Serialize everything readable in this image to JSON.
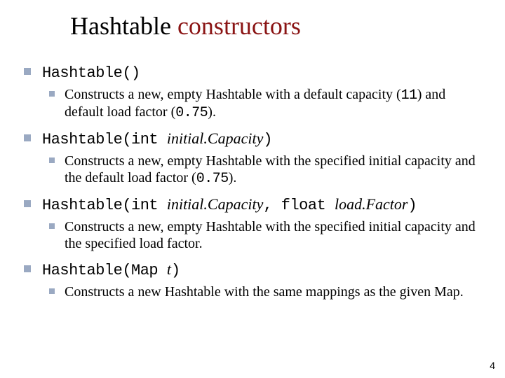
{
  "title": {
    "word1": "Hashtable",
    "word2": "constructors"
  },
  "items": [
    {
      "sig_pre": "Hashtable()",
      "desc_a": "Constructs a new, empty Hashtable with a default capacity (",
      "num1": "11",
      "desc_b": ") and default load factor (",
      "num2": "0.75",
      "desc_c": ")."
    },
    {
      "sig_pre": "Hashtable(int ",
      "sig_arg1": "initial.Capacity",
      "sig_post": ")",
      "desc_a": "Constructs a new, empty Hashtable with the specified initial capacity and the default load factor (",
      "num1": "0.75",
      "desc_b": ")."
    },
    {
      "sig_pre": "Hashtable(int ",
      "sig_arg1": "initial.Capacity",
      "sig_mid": ", float ",
      "sig_arg2": "load.Factor",
      "sig_post": ")",
      "desc": "Constructs a new, empty Hashtable with the specified initial capacity and the specified load factor."
    },
    {
      "sig_pre": "Hashtable(Map ",
      "sig_arg1": "t",
      "sig_post": ")",
      "desc": "Constructs a new Hashtable with the same mappings as the given Map."
    }
  ],
  "pagenum": "4"
}
